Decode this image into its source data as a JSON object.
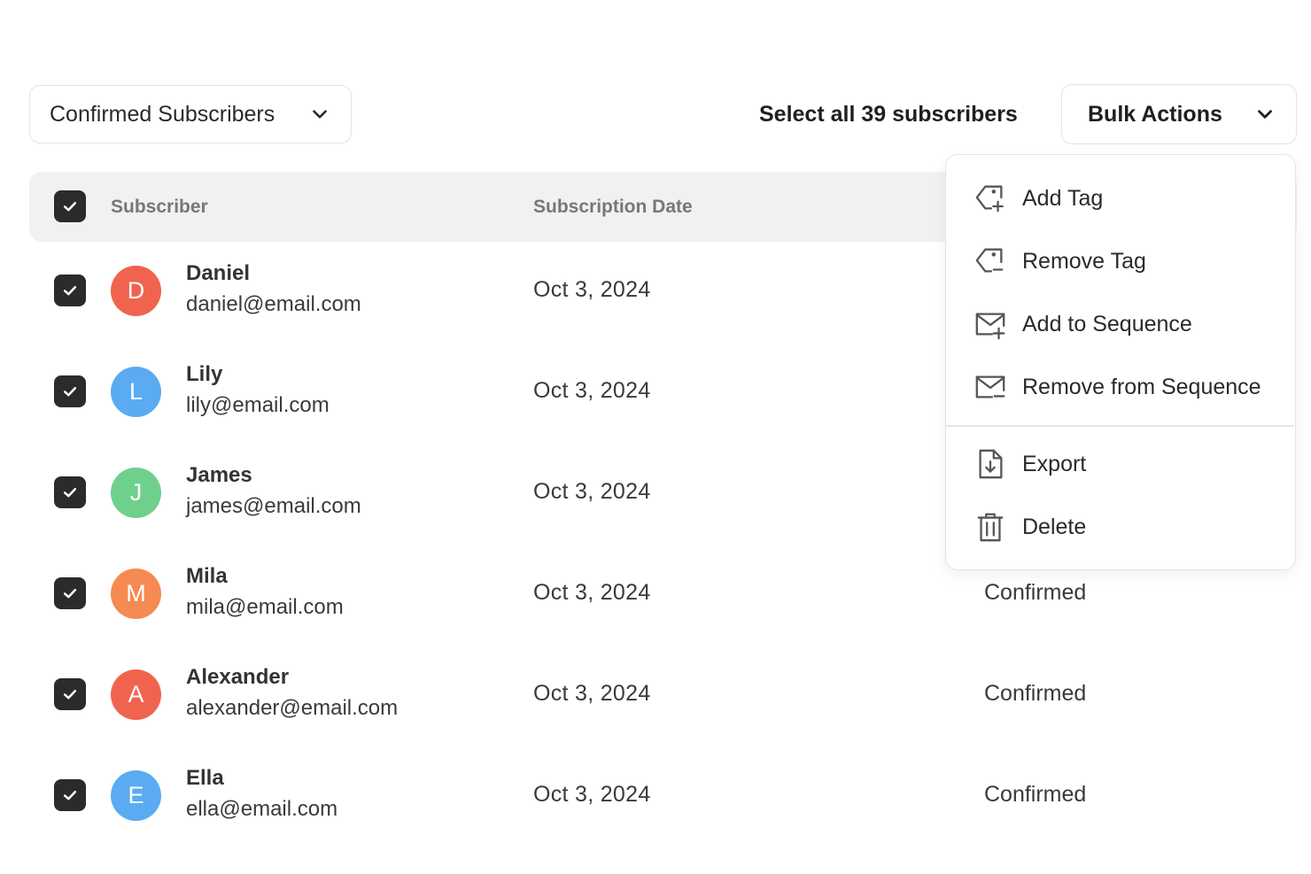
{
  "filter": {
    "selected": "Confirmed Subscribers",
    "icon": "chevron-down-icon"
  },
  "select_all": {
    "label": "Select all 39 subscribers"
  },
  "bulk_actions": {
    "label": "Bulk Actions",
    "icon": "chevron-down-icon",
    "menu": [
      {
        "label": "Add Tag",
        "icon": "tag-add-icon"
      },
      {
        "label": "Remove Tag",
        "icon": "tag-remove-icon"
      },
      {
        "label": "Add to Sequence",
        "icon": "mail-add-icon"
      },
      {
        "label": "Remove from Sequence",
        "icon": "mail-remove-icon"
      },
      {
        "label": "Export",
        "icon": "file-download-icon"
      },
      {
        "label": "Delete",
        "icon": "trash-icon"
      }
    ]
  },
  "table": {
    "columns": [
      "Subscriber",
      "Subscription Date"
    ],
    "header_checked": true,
    "rows": [
      {
        "initial": "D",
        "name": "Daniel",
        "email": "daniel@email.com",
        "date": "Oct 3, 2024",
        "status": "",
        "color": "#f0644f",
        "checked": true
      },
      {
        "initial": "L",
        "name": "Lily",
        "email": "lily@email.com",
        "date": "Oct 3, 2024",
        "status": "",
        "color": "#5aabf2",
        "checked": true
      },
      {
        "initial": "J",
        "name": "James",
        "email": "james@email.com",
        "date": "Oct 3, 2024",
        "status": "",
        "color": "#6fd08c",
        "checked": true
      },
      {
        "initial": "M",
        "name": "Mila",
        "email": "mila@email.com",
        "date": "Oct 3, 2024",
        "status": "Confirmed",
        "color": "#f58a52",
        "checked": true
      },
      {
        "initial": "A",
        "name": "Alexander",
        "email": "alexander@email.com",
        "date": "Oct 3, 2024",
        "status": "Confirmed",
        "color": "#f0644f",
        "checked": true
      },
      {
        "initial": "E",
        "name": "Ella",
        "email": "ella@email.com",
        "date": "Oct 3, 2024",
        "status": "Confirmed",
        "color": "#5aabf2",
        "checked": true
      }
    ]
  },
  "colors": {
    "checkbox": "#2b2b2b",
    "header_bg": "#f1f1f1",
    "border": "#e2e2e2"
  }
}
